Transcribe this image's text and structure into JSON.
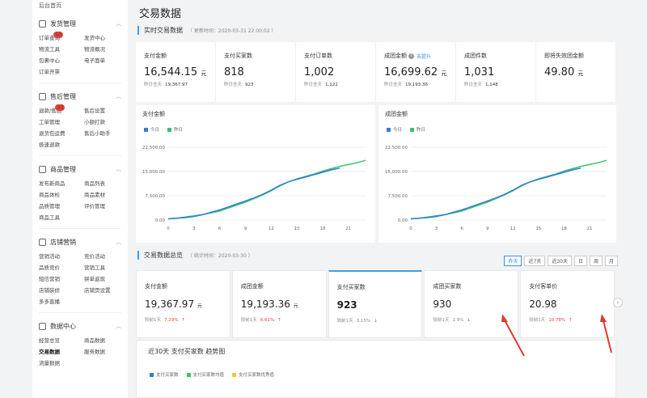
{
  "sidebar": {
    "top": "后台首页",
    "sections": [
      {
        "title": "发货管理",
        "items": [
          "订单查询",
          "发货中心",
          "物流工具",
          "物流概况",
          "包裹中心",
          "电子面单",
          "订单开票"
        ],
        "badge_item": 0,
        "badge": "50"
      },
      {
        "title": "售后管理",
        "items": [
          "退款/售后",
          "售后设置",
          "工单管理",
          "小额打款",
          "退货包运费",
          "售后小助手",
          "极速退款"
        ],
        "badge_item": 0,
        "badge": "33"
      },
      {
        "title": "商品管理",
        "items": [
          "发布新商品",
          "商品列表",
          "商品体检",
          "商品素材",
          "品质管理",
          "评价管理",
          "商品工具"
        ]
      },
      {
        "title": "店铺营销",
        "items": [
          "营销活动",
          "竞价活动",
          "品质竞价",
          "营销工具",
          "短信营销",
          "拼单返现",
          "店铺装修",
          "店铺页设置",
          "多多直播"
        ]
      },
      {
        "title": "数据中心",
        "items": [
          "经营总览",
          "商品数据",
          "交易数据",
          "服务数据",
          "流量数据"
        ],
        "active": "交易数据"
      }
    ]
  },
  "page_title": "交易数据",
  "realtime": {
    "title": "实时交易数据",
    "updated": "（ 更新时间：2020-03-31 22:00:02 ）",
    "metrics": [
      {
        "label": "支付金额",
        "value": "16,544.15",
        "unit": "元",
        "yest_label": "昨日全天",
        "yest": "19,367.97"
      },
      {
        "label": "支付买家数",
        "value": "818",
        "unit": "",
        "yest_label": "昨日全天",
        "yest": "923"
      },
      {
        "label": "支付订单数",
        "value": "1,002",
        "unit": "",
        "yest_label": "昨日全天",
        "yest": "1,122"
      },
      {
        "label": "成团金额",
        "value": "16,699.62",
        "unit": "元",
        "yest_label": "昨日全天",
        "yest": "19,193.36",
        "link": "去提升"
      },
      {
        "label": "成团件数",
        "value": "1,031",
        "unit": "",
        "yest_label": "昨日全天",
        "yest": "1,148"
      },
      {
        "label": "即将失效团金额",
        "value": "49.80",
        "unit": "元",
        "yest_label": "",
        "yest": ""
      }
    ]
  },
  "charts": [
    {
      "title": "支付金额",
      "legend": [
        "今日",
        "昨日"
      ],
      "colors": [
        "#2f7ed8",
        "#3cc26b"
      ],
      "y_ticks": [
        "22,500.00",
        "15,000.00",
        "7,500.00",
        "0.00"
      ],
      "x_ticks": [
        "0",
        "3",
        "6",
        "9",
        "12",
        "15",
        "18",
        "21"
      ]
    },
    {
      "title": "成团金额",
      "legend": [
        "今日",
        "昨日"
      ],
      "colors": [
        "#2f7ed8",
        "#3cc26b"
      ],
      "y_ticks": [
        "22,500.00",
        "15,000.00",
        "7,500.00",
        "0.00"
      ],
      "x_ticks": [
        "0",
        "3",
        "6",
        "9",
        "12",
        "15",
        "18",
        "21"
      ]
    }
  ],
  "overview": {
    "title": "交易数据总览",
    "date": "（ 统计时间：2020-03-30 ）",
    "ranges": [
      "昨天",
      "近7天",
      "近30天",
      "日",
      "周",
      "月"
    ],
    "cards": [
      {
        "label": "支付金额",
        "value": "19,367.97",
        "unit": "元",
        "cmp_label": "较前1天",
        "cmp": "7.29%",
        "dir": "up"
      },
      {
        "label": "成团金额",
        "value": "19,193.36",
        "unit": "元",
        "cmp_label": "较前1天",
        "cmp": "6.61%",
        "dir": "up"
      },
      {
        "label": "支付买家数",
        "value": "923",
        "unit": "",
        "cmp_label": "较前1天",
        "cmp": "3.15%",
        "dir": "down"
      },
      {
        "label": "成团买家数",
        "value": "930",
        "unit": "",
        "cmp_label": "较前1天",
        "cmp": "1.9%",
        "dir": "down"
      },
      {
        "label": "支付客单价",
        "value": "20.98",
        "unit": "",
        "cmp_label": "较前1天",
        "cmp": "10.78%",
        "dir": "up"
      }
    ]
  },
  "trend": {
    "title": "近30天 支付买家数 趋势图",
    "legend": [
      "支付买家数",
      "支付买家数均值",
      "支付买家数优秀值"
    ],
    "colors": [
      "#2f7ed8",
      "#3cc26b",
      "#f5c342"
    ]
  }
}
